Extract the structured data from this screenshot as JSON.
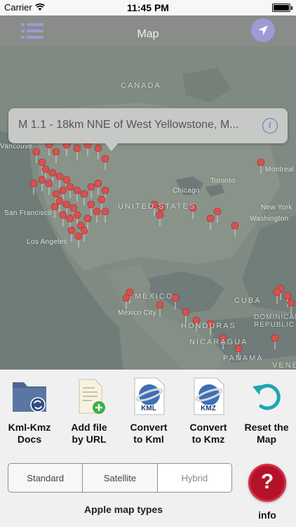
{
  "status_bar": {
    "carrier": "Carrier",
    "time": "11:45 PM"
  },
  "nav": {
    "title": "Map",
    "menu_icon": "list-icon",
    "locate_icon": "location-arrow-icon"
  },
  "map": {
    "labels": {
      "canada": "CANADA",
      "vancouver": "Vancouve",
      "montreal": "Montreal",
      "toronto": "Toronto",
      "chicago": "Chicago",
      "united_states": "UNITED STATES",
      "new_york": "New York",
      "washington": "Washington",
      "san_francisco": "San Francisco",
      "los_angeles": "Los Angeles",
      "mexico": "MEXICO",
      "mexico_city": "Mexico City",
      "cuba": "CUBA",
      "dominican_republic": "DOMINICAN REPUBLIC",
      "honduras": "HONDURAS",
      "nicaragua": "NICARAGUA",
      "panama": "PANAMA",
      "venezuela": "VENEZ"
    },
    "pin_color": "#d9514f"
  },
  "callout": {
    "title": "M 1.1 - 18km NNE of West Yellowstone, M...",
    "info_icon": "info-icon"
  },
  "actions": [
    {
      "label_line1": "Kml-Kmz",
      "label_line2": "Docs",
      "icon": "folder-sync-icon"
    },
    {
      "label_line1": "Add file",
      "label_line2": "by URL",
      "icon": "add-file-icon"
    },
    {
      "label_line1": "Convert",
      "label_line2": "to Kml",
      "icon": "kml-file-icon"
    },
    {
      "label_line1": "Convert",
      "label_line2": "to Kmz",
      "icon": "kmz-file-icon"
    },
    {
      "label_line1": "Reset the",
      "label_line2": "Map",
      "icon": "reset-icon"
    }
  ],
  "kml_badge": "KML",
  "kmz_badge": "KMZ",
  "map_types": {
    "options": [
      "Standard",
      "Satellite",
      "Hybrid"
    ],
    "selected": "Hybrid",
    "caption": "Apple map types"
  },
  "info": {
    "symbol": "?",
    "label": "info"
  },
  "colors": {
    "accent": "#9d9ad6",
    "info_red": "#b3122a",
    "pin": "#d9514f"
  }
}
